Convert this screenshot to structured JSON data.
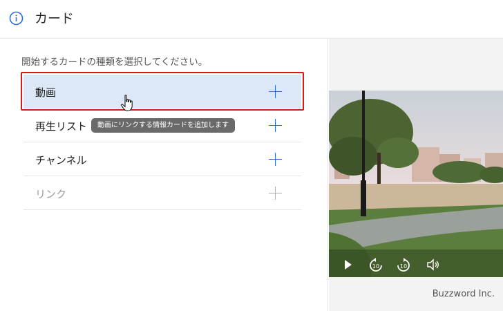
{
  "header": {
    "title": "カード"
  },
  "panel": {
    "instruction": "開始するカードの種類を選択してください。",
    "items": [
      {
        "label": "動画"
      },
      {
        "label": "再生リスト"
      },
      {
        "label": "チャンネル"
      },
      {
        "label": "リンク"
      }
    ],
    "tooltip": "動画にリンクする情報カードを追加します"
  },
  "preview": {
    "credit": "Buzzword Inc."
  },
  "colors": {
    "accent": "#2d6fc4",
    "selected_row": "#dde8f7",
    "highlight_border": "#d61a1a",
    "tooltip_bg": "#6a6a6a"
  },
  "icons": [
    "info-icon",
    "plus-icon",
    "hand-cursor-icon",
    "play-icon",
    "rewind-10-icon",
    "forward-10-icon",
    "volume-icon"
  ]
}
